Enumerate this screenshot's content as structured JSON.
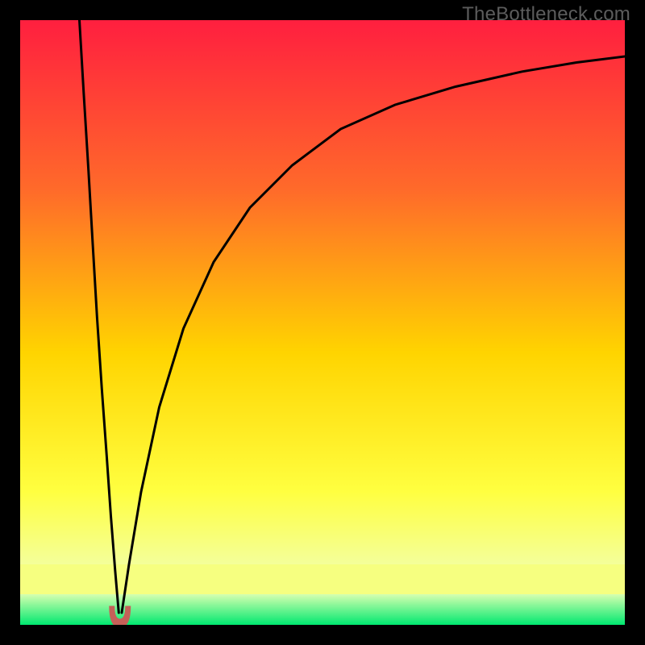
{
  "watermark": "TheBottleneck.com",
  "colors": {
    "frame": "#000000",
    "top": "#ff1f3f",
    "mid_upper": "#ff8a2a",
    "mid": "#ffd400",
    "lower_yellow": "#ffff40",
    "pale": "#f4ff9a",
    "green_band_top": "#d7ffb0",
    "green_band_bottom": "#00e870",
    "curve": "#000000",
    "blob": "#c56058"
  },
  "chart_data": {
    "type": "line",
    "title": "",
    "xlabel": "",
    "ylabel": "",
    "xlim": [
      0,
      100
    ],
    "ylim": [
      0,
      100
    ],
    "curve_minimum_x": 16.5,
    "series": [
      {
        "name": "left-branch",
        "x": [
          9.8,
          10.5,
          11.3,
          12,
          12.7,
          13.5,
          14.3,
          15,
          15.7,
          16.3
        ],
        "y": [
          100,
          88,
          75,
          63,
          51,
          39,
          28,
          18,
          9,
          2
        ]
      },
      {
        "name": "right-branch",
        "x": [
          16.8,
          18,
          20,
          23,
          27,
          32,
          38,
          45,
          53,
          62,
          72,
          83,
          92,
          100
        ],
        "y": [
          2,
          10,
          22,
          36,
          49,
          60,
          69,
          76,
          82,
          86,
          89,
          91.5,
          93,
          94
        ]
      }
    ],
    "marker": {
      "x": 16.5,
      "y": 1.2,
      "shape": "u-blob",
      "color": "#c56058"
    }
  }
}
